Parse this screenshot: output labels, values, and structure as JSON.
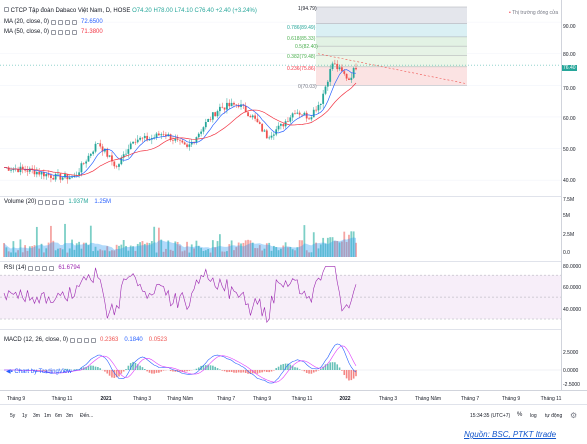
{
  "header": {
    "symbol": "CTCP Tập đoàn Dabaco Việt Nam, D, HOSE",
    "open": "O74.20",
    "high": "H78.00",
    "low": "L74.10",
    "close": "C76.40",
    "change": "+2.40 (+3.24%)",
    "market_status": "Thị trường đóng cửa"
  },
  "indicators": {
    "ma20": {
      "label": "MA (20, close, 0)",
      "value": "72.6500",
      "color": "#2962ff"
    },
    "ma50": {
      "label": "MA (50, close, 0)",
      "value": "71.3800",
      "color": "#f23645"
    },
    "volume": {
      "label": "Volume (20)",
      "v1": "1.937M",
      "v2": "1.25M"
    },
    "rsi": {
      "label": "RSI (14)",
      "value": "61.6794"
    },
    "macd": {
      "label": "MACD (12, 26, close, 0)",
      "v1": "0.2363",
      "v2": "0.1840",
      "v3": "0.0523"
    }
  },
  "fib_levels": [
    {
      "label": "1(94.79)",
      "color": "#787b86"
    },
    {
      "label": "0.786(89.49)",
      "color": "#26a69a"
    },
    {
      "label": "0.618(85.33)",
      "color": "#4caf50"
    },
    {
      "label": "0.5(82.40)",
      "color": "#4caf50"
    },
    {
      "label": "0.382(79.48)",
      "color": "#81c784"
    },
    {
      "label": "0.236(75.86)",
      "color": "#f23645"
    },
    {
      "label": "0(70.03)",
      "color": "#787b86"
    }
  ],
  "price_axis": [
    "90.00",
    "80.00",
    "70.00",
    "60.00",
    "50.00",
    "40.00"
  ],
  "price_badge": "76.40",
  "volume_axis": [
    "7.5M",
    "5M",
    "2.5M",
    "0.0"
  ],
  "rsi_axis": [
    "80.0000",
    "60.0000",
    "40.0000"
  ],
  "macd_axis": [
    "2.5000",
    "0.0000",
    "-2.5000"
  ],
  "time_axis": [
    "Tháng 9",
    "Tháng 11",
    "2021",
    "Tháng 3",
    "Tháng Năm",
    "Tháng 7",
    "Tháng 9",
    "Tháng 11",
    "2022",
    "Tháng 3",
    "Tháng Năm",
    "Tháng 7",
    "Tháng 9",
    "Tháng 11"
  ],
  "watermark": "Chart by TradingView",
  "toolbar": {
    "ranges": [
      "5y",
      "1y",
      "3m",
      "1m",
      "6m",
      "3m",
      "Đến..."
    ],
    "time": "15:34:35 (UTC+7)",
    "percent": "%",
    "log": "log",
    "auto": "tự động"
  },
  "source": "Nguồn: BSC, PTKT Itrade",
  "colors": {
    "up": "#26a69a",
    "down": "#ef5350",
    "rsi": "#9c27b0",
    "macd": "#2962ff",
    "signal": "#e040fb"
  }
}
